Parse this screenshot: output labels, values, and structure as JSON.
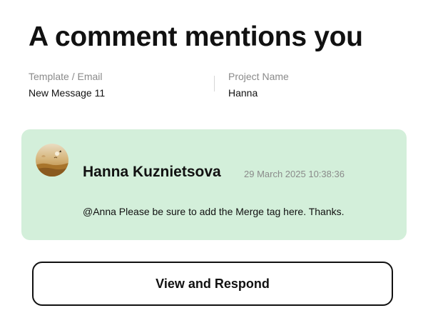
{
  "header": {
    "title": "A comment mentions you"
  },
  "meta": {
    "template_label": "Template / Email",
    "template_value": "New Message 11",
    "project_label": "Project Name",
    "project_value": "Hanna"
  },
  "comment": {
    "author": "Hanna Kuznietsova",
    "timestamp": "29 March 2025 10:38:36",
    "message": "@Anna Please be sure to add the Merge tag here. Thanks.",
    "background_color": "#d3efda"
  },
  "actions": {
    "primary_label": "View and Respond"
  }
}
